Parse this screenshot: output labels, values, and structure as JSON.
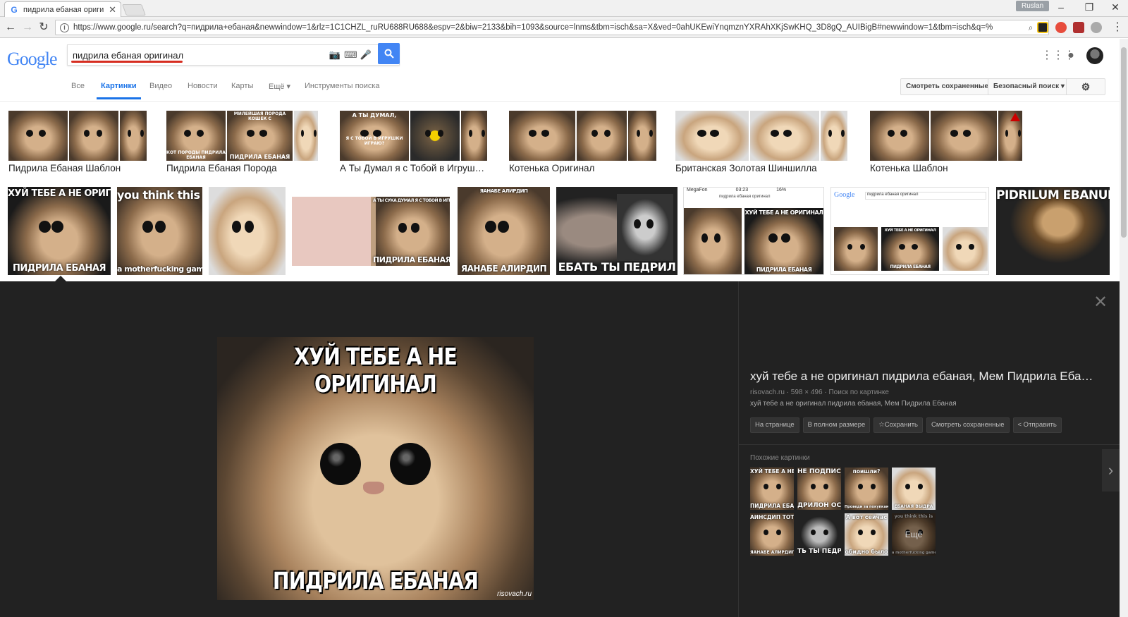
{
  "browser": {
    "tab_title": "пидрила ебаная оригин",
    "tab_favicon": "G",
    "user_name": "Ruslan",
    "url": "https://www.google.ru/search?q=пидрила+ебаная&newwindow=1&rlz=1C1CHZL_ruRU688RU688&espv=2&biw=2133&bih=1093&source=lnms&tbm=isch&sa=X&ved=0ahUKEwiYnqmznYXRAhXKjSwKHQ_3D8gQ_AUIBigB#newwindow=1&tbm=isch&q=%"
  },
  "google": {
    "logo": "Google",
    "query": "пидрила ебаная оригинал",
    "tabs": [
      "Все",
      "Картинки",
      "Видео",
      "Новости",
      "Карты",
      "Ещё ▾",
      "Инструменты поиска"
    ],
    "active_tab": "Картинки",
    "saved_button": "Смотреть сохраненные",
    "safe_search": "Безопасный поиск ▾",
    "brand_blue": "#4285f4"
  },
  "related": [
    {
      "label": "Пидрила Ебаная Шаблон"
    },
    {
      "label": "Пидрила Ебаная Порода"
    },
    {
      "label": "А Ты Думал я с Тобой в Игруш…"
    },
    {
      "label": "Котенька Оригинал"
    },
    {
      "label": "Британская Золотая Шиншилла"
    },
    {
      "label": "Котенька Шаблон"
    }
  ],
  "related_thumb_captions": {
    "r1_top": "МИЛЕЙШАЯ ПОРОДА КОШЕК С",
    "r1_bot_a": "КОТ ПОРОДЫ ПИДРИЛА ЕБАНАЯ",
    "r1_bot_b": "ПИДРИЛА ЕБАНАЯ",
    "r2_top": "А ТЫ ДУМАЛ,",
    "r2_mid": "Я С ТОБОЙ В ИГРУШКИ ИГРАЮ?"
  },
  "grid_captions": {
    "g1_top": "ХУЙ ТЕБЕ А НЕ ОРИГИНАЛ",
    "g1_bot": "ПИДРИЛА ЕБАНАЯ",
    "g2_top": "you think this is",
    "g2_bot": "a motherfucking game?",
    "g4_top": "А ТЫ СУКА ДУМАЛ Я С ТОБОЙ В ИГРУШКИ",
    "g4_bot": "ПИДРИЛА ЕБАНАЯ",
    "g5_top": "ЯАНАБЕ АЛИРДИП",
    "g5_bot": "ЯАНАБЕ АЛИРДИП",
    "g6_bot": "ЕБАТЬ ТЫ ПЕДРИЛ",
    "g7_status": "MegaFon",
    "g7_time": "03:23",
    "g7_bat": "16%",
    "g7_search": "пидрила ебаная оригинал",
    "g7_top": "ХУЙ ТЕБЕ А НЕ ОРИГИНАЛ",
    "g7_bot": "ПИДРИЛА ЕБАНАЯ",
    "g8_logo": "Google",
    "g8_search": "пидрила ебаная оригинал",
    "g8_top": "ХУЙ ТЕБЕ А НЕ ОРИГИНАЛ",
    "g8_bot": "ПИДРИЛА ЕБАНАЯ",
    "g9_top": "PIDRILUM EBANUM"
  },
  "viewer": {
    "image_top": "ХУЙ ТЕБЕ А НЕ ОРИГИНАЛ",
    "image_bottom": "ПИДРИЛА ЕБАНАЯ",
    "watermark": "risovach.ru",
    "title": "хуй тебе а не оригинал пидрила ебаная, Мем Пидрила Еба…",
    "meta": "risovach.ru · 598 × 496 · Поиск по картинке",
    "description": "хуй тебе а не оригинал пидрила ебаная, Мем Пидрила Ебаная",
    "buttons": [
      "На странице",
      "В полном размере",
      "☆Сохранить",
      "Смотреть сохраненные",
      "< Отправить"
    ],
    "similar_label": "Похожие картинки",
    "similar": [
      {
        "top": "ХУЙ ТЕБЕ А НЕ ОРИГИНА",
        "bot": "ПИДРИЛА ЕБАНАЯ"
      },
      {
        "top": "НЕ ПОДПИСАЛСЯ",
        "bot": "ДРИЛОН ОСТАЛ"
      },
      {
        "top": "поишли?",
        "bot": "Проведи за покупками"
      },
      {
        "top": "",
        "bot": "ЕБАНАЯ ВЫДРА"
      },
      {
        "top": "АИНСДИП ТОТС ЗДЕ",
        "bot": "ЯАНАБЕ АЛИРДИП"
      },
      {
        "top": "",
        "bot": "ТЬ ТЫ ПЕДРИ"
      },
      {
        "top": "А вот сейчас",
        "bot": "обидно было"
      },
      {
        "top": "you think this is",
        "bot": "a motherfucking game?"
      }
    ],
    "more_label": "Ещё"
  }
}
